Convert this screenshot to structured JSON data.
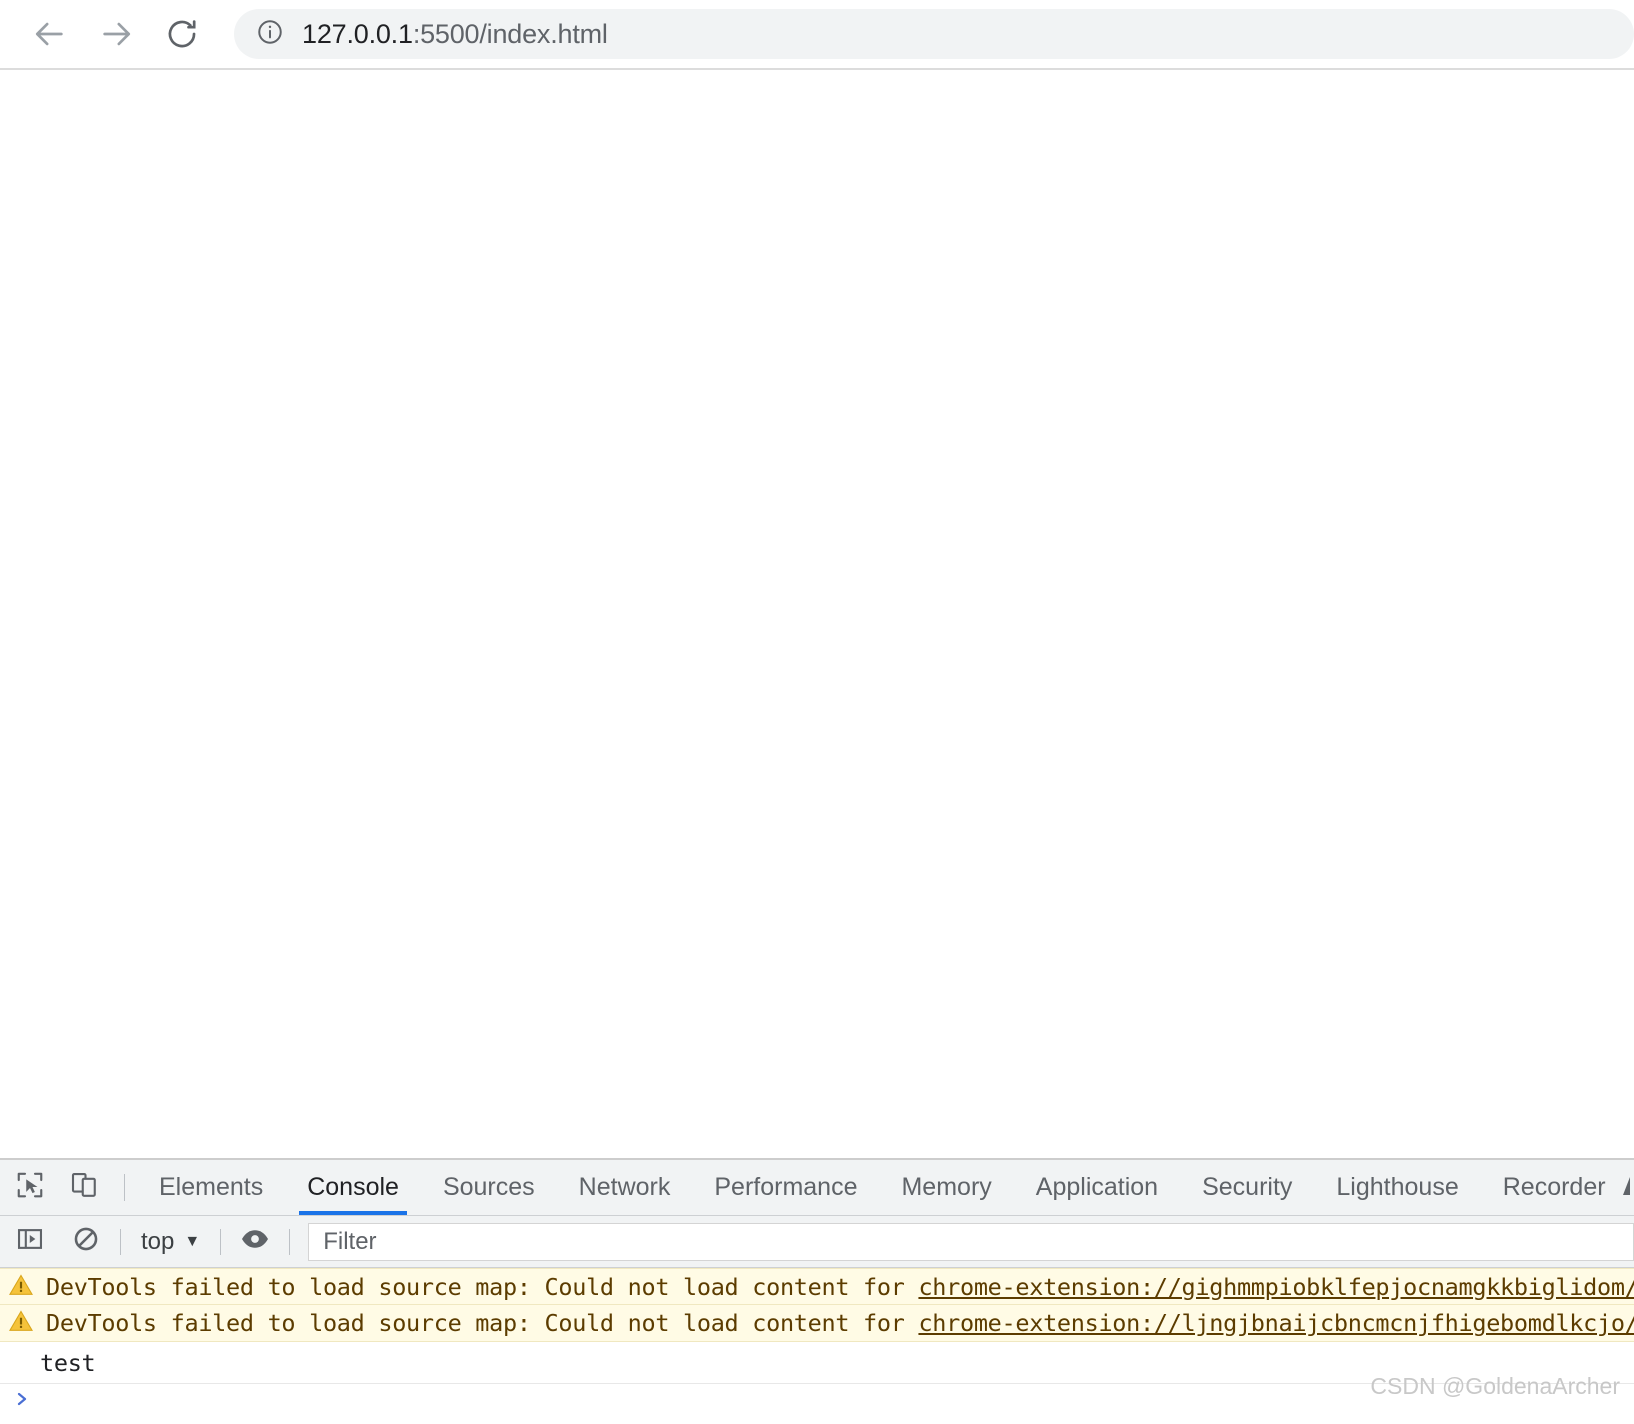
{
  "browser": {
    "nav": {
      "back_label": "Back",
      "forward_label": "Forward",
      "reload_label": "Reload"
    },
    "omnibox": {
      "url_host": "127.0.0.1",
      "url_rest": ":5500/index.html",
      "full_url": "127.0.0.1:5500/index.html",
      "security_icon": "info-circle-icon"
    }
  },
  "devtools": {
    "tools": {
      "inspect_label": "Inspect element",
      "device_label": "Toggle device toolbar"
    },
    "tabs": [
      {
        "label": "Elements",
        "active": false
      },
      {
        "label": "Console",
        "active": true
      },
      {
        "label": "Sources",
        "active": false
      },
      {
        "label": "Network",
        "active": false
      },
      {
        "label": "Performance",
        "active": false
      },
      {
        "label": "Memory",
        "active": false
      },
      {
        "label": "Application",
        "active": false
      },
      {
        "label": "Security",
        "active": false
      },
      {
        "label": "Lighthouse",
        "active": false
      },
      {
        "label": "Recorder",
        "active": false
      }
    ],
    "console_toolbar": {
      "sidebar_toggle_label": "Show console sidebar",
      "clear_label": "Clear console",
      "context": "top",
      "context_caret": "▼",
      "eye_label": "Create live expression",
      "filter_placeholder": "Filter"
    },
    "messages": [
      {
        "type": "warning",
        "icon": "warning-triangle-icon",
        "text": "DevTools failed to load source map: Could not load content for ",
        "link": "chrome-extension://gighmmpiobklfepjocnamgkkbiglidom/browse"
      },
      {
        "type": "warning",
        "icon": "warning-triangle-icon",
        "text": "DevTools failed to load source map: Could not load content for ",
        "link": "chrome-extension://ljngjbnaijcbncmcnjfhigebomdlkcjo/conten"
      },
      {
        "type": "log",
        "icon": "",
        "text": "test",
        "link": ""
      }
    ],
    "prompt": {
      "symbol": ">",
      "value": ""
    }
  },
  "watermark": {
    "text": "CSDN @GoldenaArcher"
  },
  "colors": {
    "accent": "#1a73e8",
    "toolbar_bg": "#f1f3f4",
    "warning_bg": "#fffbe5",
    "warning_text": "#5c3c00",
    "warning_icon": "#e8b339"
  }
}
